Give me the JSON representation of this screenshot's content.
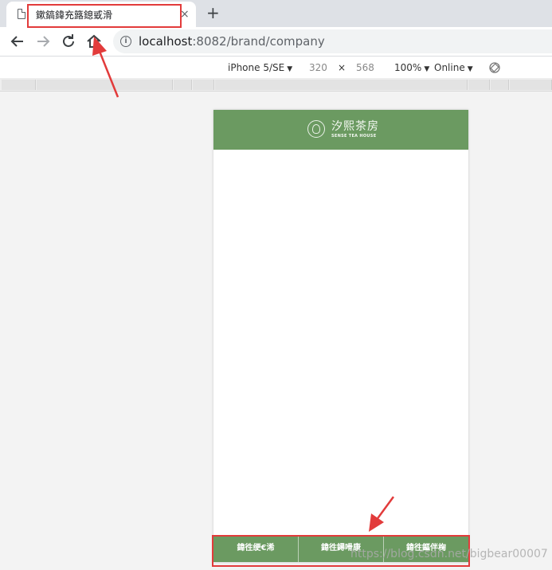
{
  "browser": {
    "tab": {
      "title": "鏉鎬鍏充簬鎴戜滑",
      "close_glyph": "×"
    },
    "new_tab_glyph": "+",
    "address": {
      "host": "localhost",
      "rest": ":8082/brand/company",
      "info_glyph": "i"
    }
  },
  "device_toolbar": {
    "device": "iPhone 5/SE",
    "width": "320",
    "times": "×",
    "height": "568",
    "zoom": "100%",
    "network": "Online"
  },
  "app": {
    "brand_cn": "汐熙茶房",
    "brand_en": "SENSE TEA HOUSE",
    "tabs": [
      {
        "label": "鍏徃绠€浠"
      },
      {
        "label": "鍏徃鐞嗗康"
      },
      {
        "label": "鍏徃鏂伴椈"
      }
    ],
    "theme_color": "#6b9a61"
  },
  "annotation_color": "#e23b3b",
  "watermark": "https://blog.csdn.net/bigbear00007"
}
